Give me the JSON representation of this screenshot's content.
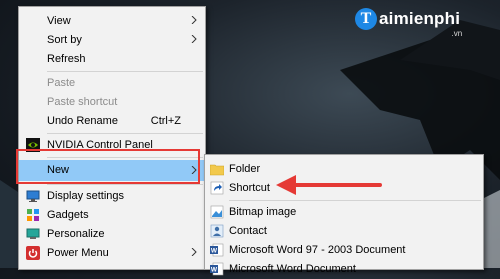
{
  "logo": {
    "letter": "T",
    "text": "aimienphi",
    "suffix": ".vn"
  },
  "context_menu": {
    "view": "View",
    "sort_by": "Sort by",
    "refresh": "Refresh",
    "paste": "Paste",
    "paste_shortcut": "Paste shortcut",
    "undo_rename": "Undo Rename",
    "undo_shortcut": "Ctrl+Z",
    "nvidia": "NVIDIA Control Panel",
    "new": "New",
    "display_settings": "Display settings",
    "gadgets": "Gadgets",
    "personalize": "Personalize",
    "power_menu": "Power Menu"
  },
  "new_submenu": {
    "folder": "Folder",
    "shortcut": "Shortcut",
    "bitmap": "Bitmap image",
    "contact": "Contact",
    "word97": "Microsoft Word 97 - 2003 Document",
    "word": "Microsoft Word Document"
  },
  "colors": {
    "highlight": "#91c9f7",
    "annotation_red": "#e53935"
  }
}
